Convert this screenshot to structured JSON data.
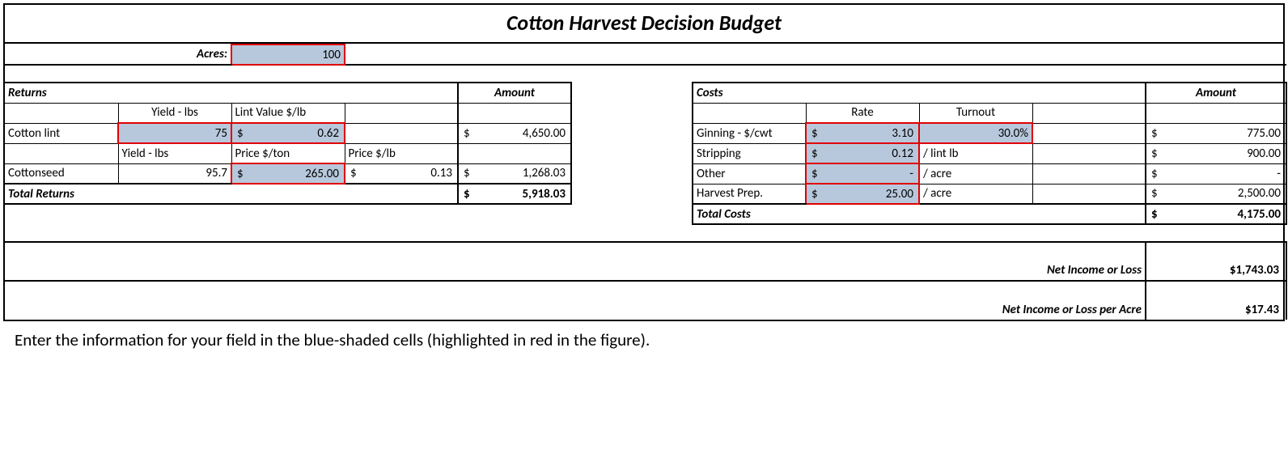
{
  "title": "Cotton Harvest Decision Budget",
  "acres": {
    "label": "Acres:",
    "value": "100"
  },
  "returns": {
    "header": "Returns",
    "amountHeader": "Amount",
    "yieldLbs1": "Yield - lbs",
    "lintValueLabel": "Lint Value $/lb",
    "cottonLint": {
      "label": "Cotton lint",
      "yield": "75",
      "lintValue": "0.62",
      "amount": "4,650.00"
    },
    "yieldLbs2": "Yield - lbs",
    "priceTonLabel": "Price $/ton",
    "priceLbLabel": "Price $/lb",
    "cottonseed": {
      "label": "Cottonseed",
      "yield": "95.7",
      "priceTon": "265.00",
      "priceLb": "0.13",
      "amount": "1,268.03"
    },
    "total": {
      "label": "Total Returns",
      "amount": "5,918.03"
    }
  },
  "costs": {
    "header": "Costs",
    "amountHeader": "Amount",
    "rateLabel": "Rate",
    "turnoutLabel": "Turnout",
    "ginning": {
      "label": "Ginning - $/cwt",
      "rate": "3.10",
      "turnout": "30.0%",
      "amount": "775.00"
    },
    "stripping": {
      "label": "Stripping",
      "rate": "0.12",
      "unit": "/ lint lb",
      "amount": "900.00"
    },
    "other": {
      "label": "Other",
      "rate": "-",
      "unit": "/ acre",
      "amount": "-"
    },
    "harvestPrep": {
      "label": "Harvest Prep.",
      "rate": "25.00",
      "unit": "/ acre",
      "amount": "2,500.00"
    },
    "total": {
      "label": "Total Costs",
      "amount": "4,175.00"
    }
  },
  "net": {
    "label": "Net Income or Loss",
    "amount": "$1,743.03"
  },
  "netPerAcre": {
    "label": "Net Income or Loss per Acre",
    "amount": "$17.43"
  },
  "dollar": "$",
  "caption": "Enter the information for your field in the blue-shaded cells (highlighted in red in the figure)."
}
